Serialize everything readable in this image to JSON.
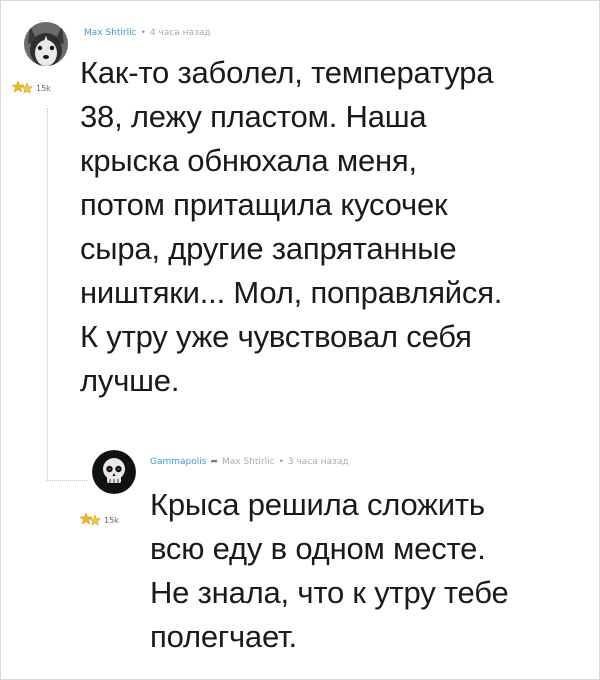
{
  "comments": [
    {
      "author": "Max Shtirlic",
      "timestamp": "4 часа назад",
      "rank_count": "15k",
      "avatar_icon": "husky-dog-avatar-icon",
      "rank_icon": "gold-stars-rank-icon",
      "text_lines": [
        "Как-то заболел, температура",
        "38, лежу пластом. Наша",
        "крыска обнюхала меня,",
        "потом притащила кусочек",
        "сыра, другие запрятанные",
        "ништяки... Мол, поправляйся.",
        "К утру уже чувствовал себя",
        "лучше."
      ]
    },
    {
      "author": "Gammapolis",
      "reply_to": "Max Shtirlic",
      "timestamp": "3 часа назад",
      "rank_count": "15k",
      "avatar_icon": "skull-avatar-icon",
      "rank_icon": "gold-stars-rank-icon",
      "reply_icon": "reply-arrow-icon",
      "text_lines": [
        "Крыса решила сложить",
        "всю еду в одном месте.",
        "Не знала, что к утру тебе",
        "полегчает."
      ]
    }
  ],
  "colors": {
    "author_link": "#3a9bd5",
    "meta_gray": "#aaaaaa",
    "text": "#1a1a1a",
    "rank_gold": "#f3b81f"
  }
}
